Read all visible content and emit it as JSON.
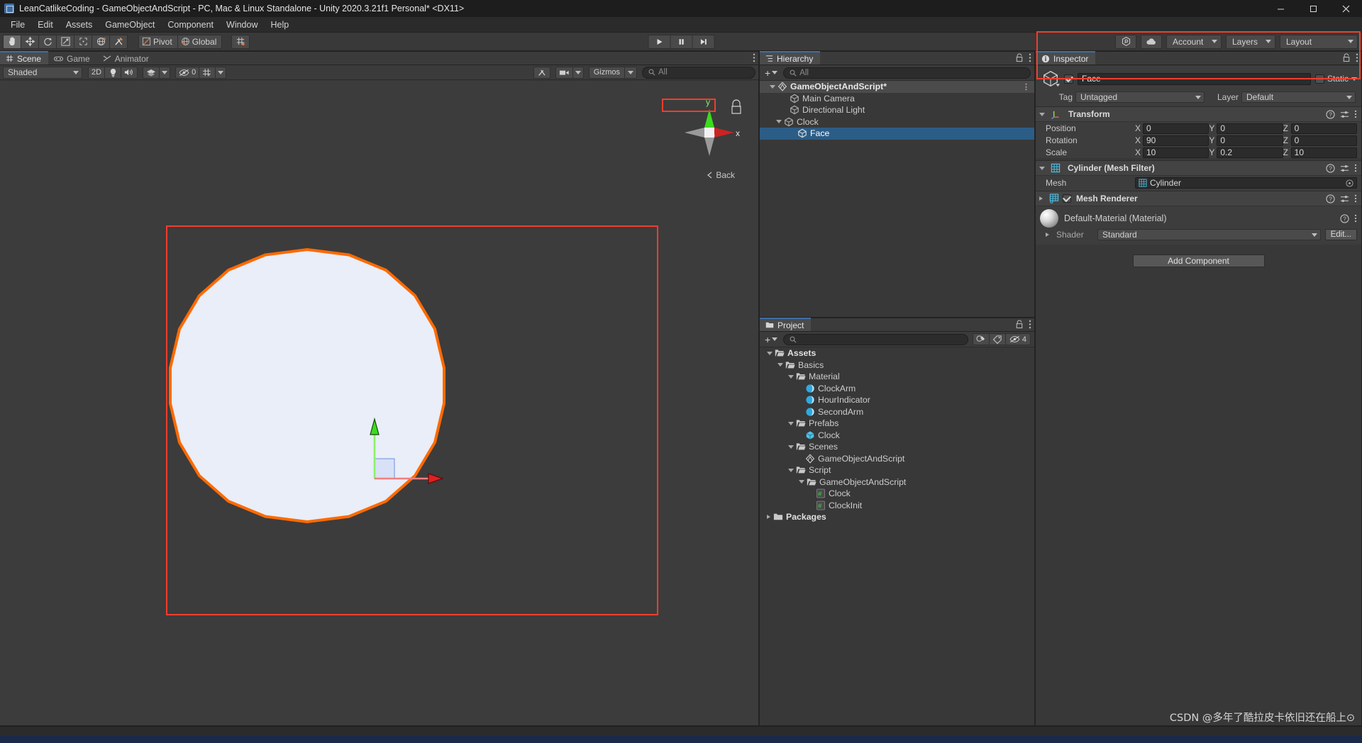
{
  "window": {
    "title": "LeanCatlikeCoding - GameObjectAndScript - PC, Mac & Linux Standalone - Unity 2020.3.21f1 Personal* <DX11>",
    "minimize_label": "–",
    "maximize_label": "❐",
    "close_label": "✕"
  },
  "menubar": {
    "items": [
      {
        "label": "File"
      },
      {
        "label": "Edit"
      },
      {
        "label": "Assets"
      },
      {
        "label": "GameObject"
      },
      {
        "label": "Component"
      },
      {
        "label": "Window"
      },
      {
        "label": "Help"
      }
    ]
  },
  "toolbar": {
    "tools": [
      {
        "name": "hand-tool",
        "icon": "hand"
      },
      {
        "name": "move-tool",
        "icon": "move"
      },
      {
        "name": "rotate-tool",
        "icon": "rotate"
      },
      {
        "name": "scale-tool",
        "icon": "scale"
      },
      {
        "name": "rect-tool",
        "icon": "rect"
      },
      {
        "name": "transform-tool",
        "icon": "transform"
      },
      {
        "name": "custom-tool",
        "icon": "wrench"
      }
    ],
    "pivot_label": "Pivot",
    "global_label": "Global",
    "grid_snap_label": "grid-snap",
    "play_label": "Play",
    "pause_label": "Pause",
    "step_label": "Step",
    "collab_label": "collab-icon",
    "cloud_label": "cloud-icon",
    "account_label": "Account",
    "layers_label": "Layers",
    "layout_label": "Layout"
  },
  "scene_panel": {
    "tabs": [
      {
        "label": "Scene",
        "icon": "grid-icon",
        "active": true
      },
      {
        "label": "Game",
        "icon": "gamepad-icon",
        "active": false
      },
      {
        "label": "Animator",
        "icon": "animator-icon",
        "active": false
      }
    ],
    "draw_mode": "Shaded",
    "mode_2d": "2D",
    "lighting_icon": "lightbulb-icon",
    "audio_icon": "speaker-icon",
    "fx_icon": "effects-icon",
    "visibility_count": "0",
    "grid_icon": "grid-visibility-icon",
    "gizmos_label": "Gizmos",
    "search_placeholder": "All",
    "view_gizmo": {
      "axis_x": "x",
      "axis_y": "y",
      "orientation_label": "Back"
    },
    "selection_color": "#ff6a00",
    "disc_color": "#e9eef9",
    "annotation_color": "#ef3e2c"
  },
  "hierarchy": {
    "tab_label": "Hierarchy",
    "search_placeholder": "All",
    "add_label": "+",
    "items": [
      {
        "label": "GameObjectAndScript*",
        "depth": 0,
        "icon": "scene-icon",
        "expanded": true,
        "selected": false,
        "root": true
      },
      {
        "label": "Main Camera",
        "depth": 1,
        "icon": "gameobject-icon",
        "expanded": null,
        "selected": false,
        "root": false
      },
      {
        "label": "Directional Light",
        "depth": 1,
        "icon": "gameobject-icon",
        "expanded": null,
        "selected": false,
        "root": false
      },
      {
        "label": "Clock",
        "depth": 1,
        "icon": "gameobject-icon",
        "expanded": true,
        "selected": false,
        "root": false
      },
      {
        "label": "Face",
        "depth": 2,
        "icon": "gameobject-icon",
        "expanded": null,
        "selected": true,
        "root": false
      }
    ]
  },
  "project": {
    "tab_label": "Project",
    "search_placeholder": "",
    "add_label": "+",
    "favorites_icon": "color-picker-icon",
    "label_icon": "tag-icon",
    "hidden_count": "4",
    "items": [
      {
        "label": "Assets",
        "depth": 0,
        "icon": "folder-open-icon",
        "expanded": true,
        "bold": true
      },
      {
        "label": "Basics",
        "depth": 1,
        "icon": "folder-open-icon",
        "expanded": true,
        "bold": false
      },
      {
        "label": "Material",
        "depth": 2,
        "icon": "folder-open-icon",
        "expanded": true,
        "bold": false
      },
      {
        "label": "ClockArm",
        "depth": 3,
        "icon": "material-icon",
        "expanded": null,
        "bold": false
      },
      {
        "label": "HourIndicator",
        "depth": 3,
        "icon": "material-icon",
        "expanded": null,
        "bold": false
      },
      {
        "label": "SecondArm",
        "depth": 3,
        "icon": "material-icon",
        "expanded": null,
        "bold": false
      },
      {
        "label": "Prefabs",
        "depth": 2,
        "icon": "folder-open-icon",
        "expanded": true,
        "bold": false
      },
      {
        "label": "Clock",
        "depth": 3,
        "icon": "prefab-icon",
        "expanded": null,
        "bold": false
      },
      {
        "label": "Scenes",
        "depth": 2,
        "icon": "folder-open-icon",
        "expanded": true,
        "bold": false
      },
      {
        "label": "GameObjectAndScript",
        "depth": 3,
        "icon": "scene-icon",
        "expanded": null,
        "bold": false
      },
      {
        "label": "Script",
        "depth": 2,
        "icon": "folder-open-icon",
        "expanded": true,
        "bold": false
      },
      {
        "label": "GameObjectAndScript",
        "depth": 3,
        "icon": "folder-open-icon",
        "expanded": true,
        "bold": false
      },
      {
        "label": "Clock",
        "depth": 4,
        "icon": "script-icon",
        "expanded": null,
        "bold": false
      },
      {
        "label": "ClockInit",
        "depth": 4,
        "icon": "script-icon",
        "expanded": null,
        "bold": false
      },
      {
        "label": "Packages",
        "depth": 0,
        "icon": "folder-icon",
        "expanded": false,
        "bold": true
      }
    ]
  },
  "inspector": {
    "tab_label": "Inspector",
    "object_name": "Face",
    "enabled": true,
    "static_label": "Static",
    "tag_label": "Tag",
    "tag_value": "Untagged",
    "layer_label": "Layer",
    "layer_value": "Default",
    "transform": {
      "title": "Transform",
      "rows": [
        {
          "label": "Position",
          "x": "0",
          "y": "0",
          "z": "0"
        },
        {
          "label": "Rotation",
          "x": "90",
          "y": "0",
          "z": "0"
        },
        {
          "label": "Scale",
          "x": "10",
          "y": "0.2",
          "z": "10"
        }
      ],
      "axis_labels": [
        "X",
        "Y",
        "Z"
      ]
    },
    "mesh_filter": {
      "title": "Cylinder (Mesh Filter)",
      "mesh_label": "Mesh",
      "mesh_value": "Cylinder"
    },
    "mesh_renderer": {
      "title": "Mesh Renderer",
      "enabled": true,
      "material_name": "Default-Material (Material)",
      "shader_label": "Shader",
      "shader_value": "Standard",
      "edit_label": "Edit..."
    },
    "add_component_label": "Add Component"
  },
  "footer": {
    "watermark": "CSDN @多年了酷拉皮卡依旧还在船上⊙"
  }
}
